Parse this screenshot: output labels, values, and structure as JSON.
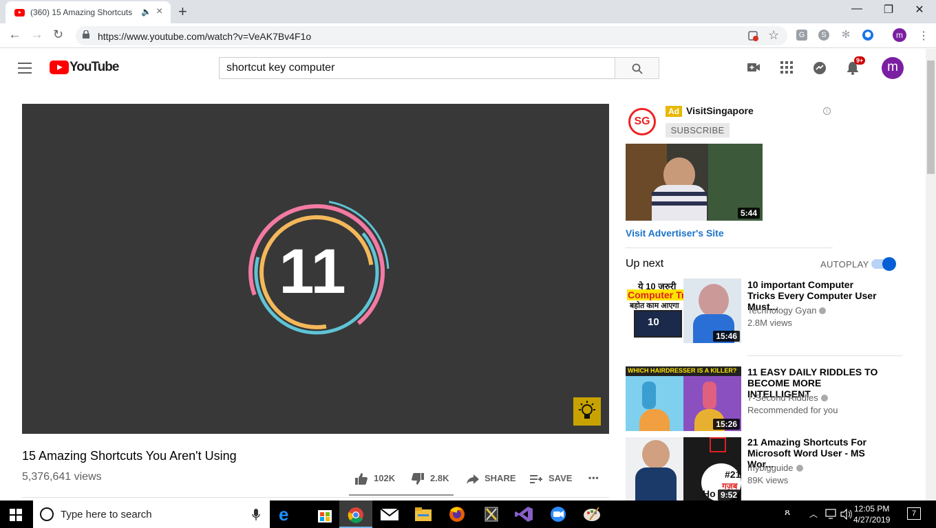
{
  "browser": {
    "tab_title": "(360) 15 Amazing Shortcuts",
    "tab_close": "×",
    "new_tab": "+",
    "url": "https://www.youtube.com/watch?v=VeAK7Bv4F1o",
    "profile_initial": "m",
    "window": {
      "minimize": "—",
      "restore": "❐",
      "close": "✕"
    }
  },
  "youtube": {
    "logo_text": "YouTube",
    "search_value": "shortcut key computer",
    "notification_badge": "9+",
    "avatar_initial": "m"
  },
  "video": {
    "title": "15 Amazing Shortcuts You Aren't Using",
    "views": "5,376,641 views",
    "overlay_number": "11",
    "likes": "102K",
    "dislikes": "2.8K",
    "share_label": "SHARE",
    "save_label": "SAVE",
    "more_label": "•••"
  },
  "ad": {
    "logo_text": "SG",
    "badge": "Ad",
    "advertiser": "VisitSingapore",
    "subscribe_label": "SUBSCRIBE",
    "info": "i",
    "duration": "5:44",
    "visit_label": "Visit Advertiser's Site"
  },
  "upnext": {
    "heading": "Up next",
    "autoplay_label": "AUTOPLAY",
    "autoplay_on": true
  },
  "recommendations": [
    {
      "title": "10 important Computer Tricks Every Computer User Must...",
      "channel": "Technology Gyan",
      "meta": "2.8M views",
      "duration": "15:46",
      "thumb_text1": "ये 10 ज़रुरी",
      "thumb_text2": "Computer Tricks",
      "thumb_text3": "बहोत काम आएगा",
      "thumb_text4": "10"
    },
    {
      "title": "11 EASY DAILY RIDDLES TO BECOME MORE INTELLIGENT",
      "channel": "7-Second Riddles",
      "meta": "Recommended for you",
      "duration": "15:26",
      "thumb_text1": "WHICH HAIRDRESSER IS A KILLER?"
    },
    {
      "title": "21 Amazing Shortcuts For Microsoft Word User - MS Wor...",
      "channel": "mybigguide",
      "meta": "89K views",
      "duration": "9:52",
      "thumb_text1": "#21",
      "thumb_text2": "गज़ब",
      "thumb_text3": "Ho"
    }
  ],
  "taskbar": {
    "search_placeholder": "Type here to search",
    "time": "12:05 PM",
    "date": "4/27/2019",
    "notif_count": "7"
  },
  "colors": {
    "brand_red": "#ff0000",
    "link_blue": "#1a73c8",
    "toggle_blue": "#065fd4",
    "ad_yellow": "#e6b800",
    "player_bg": "#383838"
  }
}
